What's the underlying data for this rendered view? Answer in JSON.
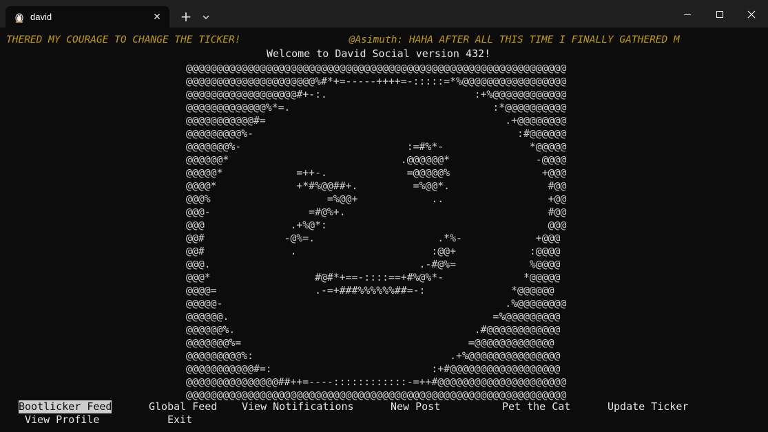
{
  "window": {
    "tab_title": "david",
    "tab_icon": "linux-penguin-icon",
    "new_tab_icon": "plus-icon",
    "dropdown_icon": "chevron-down-icon"
  },
  "terminal": {
    "ticker": "THERED MY COURAGE TO CHANGE THE TICKER!                  @Asimuth: HAHA AFTER ALL THIS TIME I FINALLY GATHERED M",
    "welcome": "Welcome to David Social version 432!",
    "art": [
      "@@@@@@@@@@@@@@@@@@@@@@@@@@@@@@@@@@@@@@@@@@@@@@@@@@@@@@@@@@@@@@",
      "@@@@@@@@@@@@@@@@@@@@@%#*+=-----++++=-:::::=*%@@@@@@@@@@@@@@@@@",
      "@@@@@@@@@@@@@@@@@@#+-:.                        :+%@@@@@@@@@@@@",
      "@@@@@@@@@@@@@%*=.                                 :*@@@@@@@@@@",
      "@@@@@@@@@@@#=                                       .+@@@@@@@@",
      "@@@@@@@@@%-                                           :#@@@@@@",
      "@@@@@@@%-                           :=#%*-              *@@@@@",
      "@@@@@@*                            .@@@@@@*              -@@@@",
      "@@@@@*            =++-.             =@@@@@%               +@@@",
      "@@@@*             +*#%@@##+.         =%@@*.                #@@",
      "@@@%                   =%@@+            ..                 +@@",
      "@@@-                =#@%+.                                 #@@",
      "@@@              .+%@*:                                    @@@",
      "@@#             -@%=.                    .*%-            +@@@",
      "@@#              .                      :@@+            :@@@@",
      "@@@.                                  .-#@%=            %@@@@",
      "@@@*                 #@#*+==-::::==+#%@%*-             *@@@@@",
      "@@@@=                .-=+###%%%%%%##=-:              *@@@@@@",
      "@@@@@-                                              .%@@@@@@@@",
      "@@@@@@.                                           =%@@@@@@@@@",
      "@@@@@@%.                                       .#@@@@@@@@@@@@",
      "@@@@@@@%=                                     =@@@@@@@@@@@@@",
      "@@@@@@@@@%:                                .+%@@@@@@@@@@@@@@@",
      "@@@@@@@@@@@#=:                          :+#@@@@@@@@@@@@@@@@@@",
      "@@@@@@@@@@@@@@@##++=----::::::::::::-=++#@@@@@@@@@@@@@@@@@@@@@",
      "@@@@@@@@@@@@@@@@@@@@@@@@@@@@@@@@@@@@@@@@@@@@@@@@@@@@@@@@@@@@@@"
    ],
    "menu": [
      "Bootlicker Feed",
      "Global Feed",
      "View Notifications",
      "New Post",
      "Pet the Cat",
      "Update Ticker",
      "View Profile",
      "Exit"
    ],
    "selected_menu_item": "Bootlicker Feed",
    "colors": {
      "background": "#0c0c0c",
      "ticker": "#c19c00",
      "text": "#cccccc",
      "selection_bg": "#cccccc"
    }
  }
}
